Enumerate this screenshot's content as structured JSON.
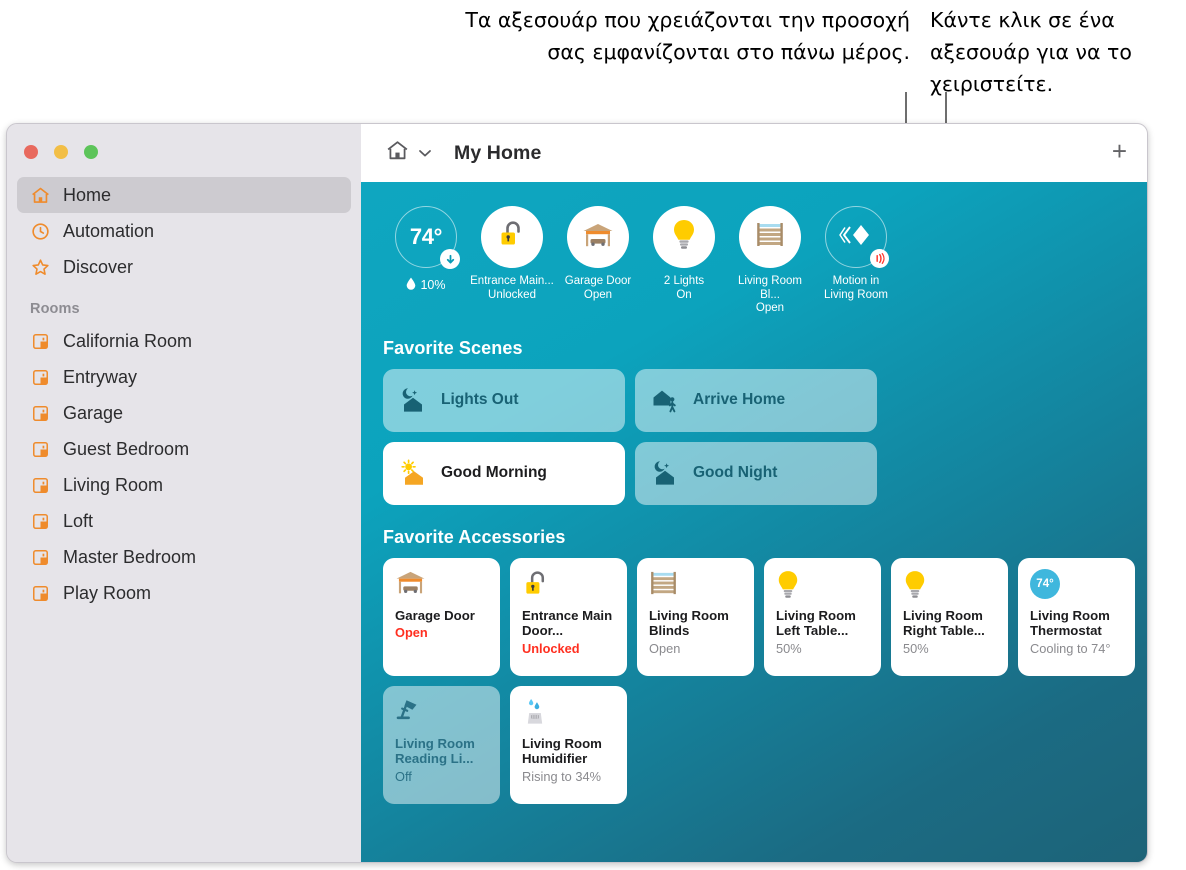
{
  "callouts": {
    "left": "Τα αξεσουάρ που χρειάζονται την προσοχή σας εμφανίζονται στο πάνω μέρος.",
    "right": "Κάντε κλικ σε ένα αξεσουάρ για να το χειριστείτε."
  },
  "window": {
    "traffic_lights": [
      {
        "name": "close",
        "color": "#e8695e"
      },
      {
        "name": "minimize",
        "color": "#f2be46"
      },
      {
        "name": "zoom",
        "color": "#5dc45a"
      }
    ]
  },
  "sidebar": {
    "items": [
      {
        "label": "Home",
        "icon": "house-icon",
        "selected": true
      },
      {
        "label": "Automation",
        "icon": "clock-icon",
        "selected": false
      },
      {
        "label": "Discover",
        "icon": "star-icon",
        "selected": false
      }
    ],
    "rooms_header": "Rooms",
    "rooms": [
      {
        "label": "California Room",
        "icon": "room-icon"
      },
      {
        "label": "Entryway",
        "icon": "room-icon"
      },
      {
        "label": "Garage",
        "icon": "room-icon"
      },
      {
        "label": "Guest Bedroom",
        "icon": "room-icon"
      },
      {
        "label": "Living Room",
        "icon": "room-icon"
      },
      {
        "label": "Loft",
        "icon": "room-icon"
      },
      {
        "label": "Master Bedroom",
        "icon": "room-icon"
      },
      {
        "label": "Play Room",
        "icon": "room-icon"
      }
    ]
  },
  "titlebar": {
    "home_icon": "house-icon",
    "chevron": "chevron-down-icon",
    "title": "My Home",
    "add_label": "+"
  },
  "status": {
    "temperature": "74°",
    "humidity": "10%",
    "tiles": [
      {
        "icon": "unlocked-padlock-icon",
        "line1": "Entrance Main...",
        "line2": "Unlocked"
      },
      {
        "icon": "garage-door-icon",
        "line1": "Garage Door",
        "line2": "Open"
      },
      {
        "icon": "lightbulb-icon",
        "line1": "2 Lights",
        "line2": "On"
      },
      {
        "icon": "blinds-icon",
        "line1": "Living Room Bl...",
        "line2": "Open"
      },
      {
        "icon": "motion-sensor-icon",
        "line1": "Motion in",
        "line2": "Living Room"
      }
    ]
  },
  "scenes": {
    "title": "Favorite Scenes",
    "items": [
      {
        "label": "Lights Out",
        "icon": "moon-house-icon",
        "active": false
      },
      {
        "label": "Arrive Home",
        "icon": "house-person-icon",
        "active": false
      },
      {
        "label": "Good Morning",
        "icon": "sun-house-icon",
        "active": true
      },
      {
        "label": "Good Night",
        "icon": "moon-house-icon",
        "active": false
      }
    ]
  },
  "accessories": {
    "title": "Favorite Accessories",
    "items": [
      {
        "name": "Garage Door",
        "state": "Open",
        "icon": "garage-door-icon",
        "alert": true,
        "off": false
      },
      {
        "name": "Entrance Main Door...",
        "state": "Unlocked",
        "icon": "unlocked-padlock-icon",
        "alert": true,
        "off": false
      },
      {
        "name": "Living Room Blinds",
        "state": "Open",
        "icon": "blinds-icon",
        "alert": false,
        "off": false
      },
      {
        "name": "Living Room Left Table...",
        "state": "50%",
        "icon": "lightbulb-icon",
        "alert": false,
        "off": false
      },
      {
        "name": "Living Room Right Table...",
        "state": "50%",
        "icon": "lightbulb-icon",
        "alert": false,
        "off": false
      },
      {
        "name": "Living Room Thermostat",
        "state": "Cooling to 74°",
        "icon": "thermostat-icon",
        "alert": false,
        "off": false,
        "badge": "74°"
      },
      {
        "name": "Living Room Reading Li...",
        "state": "Off",
        "icon": "desk-lamp-icon",
        "alert": false,
        "off": true
      },
      {
        "name": "Living Room Humidifier",
        "state": "Rising to 34%",
        "icon": "humidifier-icon",
        "alert": false,
        "off": false
      }
    ]
  },
  "colors": {
    "accent_orange": "#ef8b2c",
    "teal_light": "#0fa6c0",
    "teal_dark": "#1d6378",
    "alert_red": "#ff2f20",
    "bulb_yellow": "#ffcc00"
  }
}
